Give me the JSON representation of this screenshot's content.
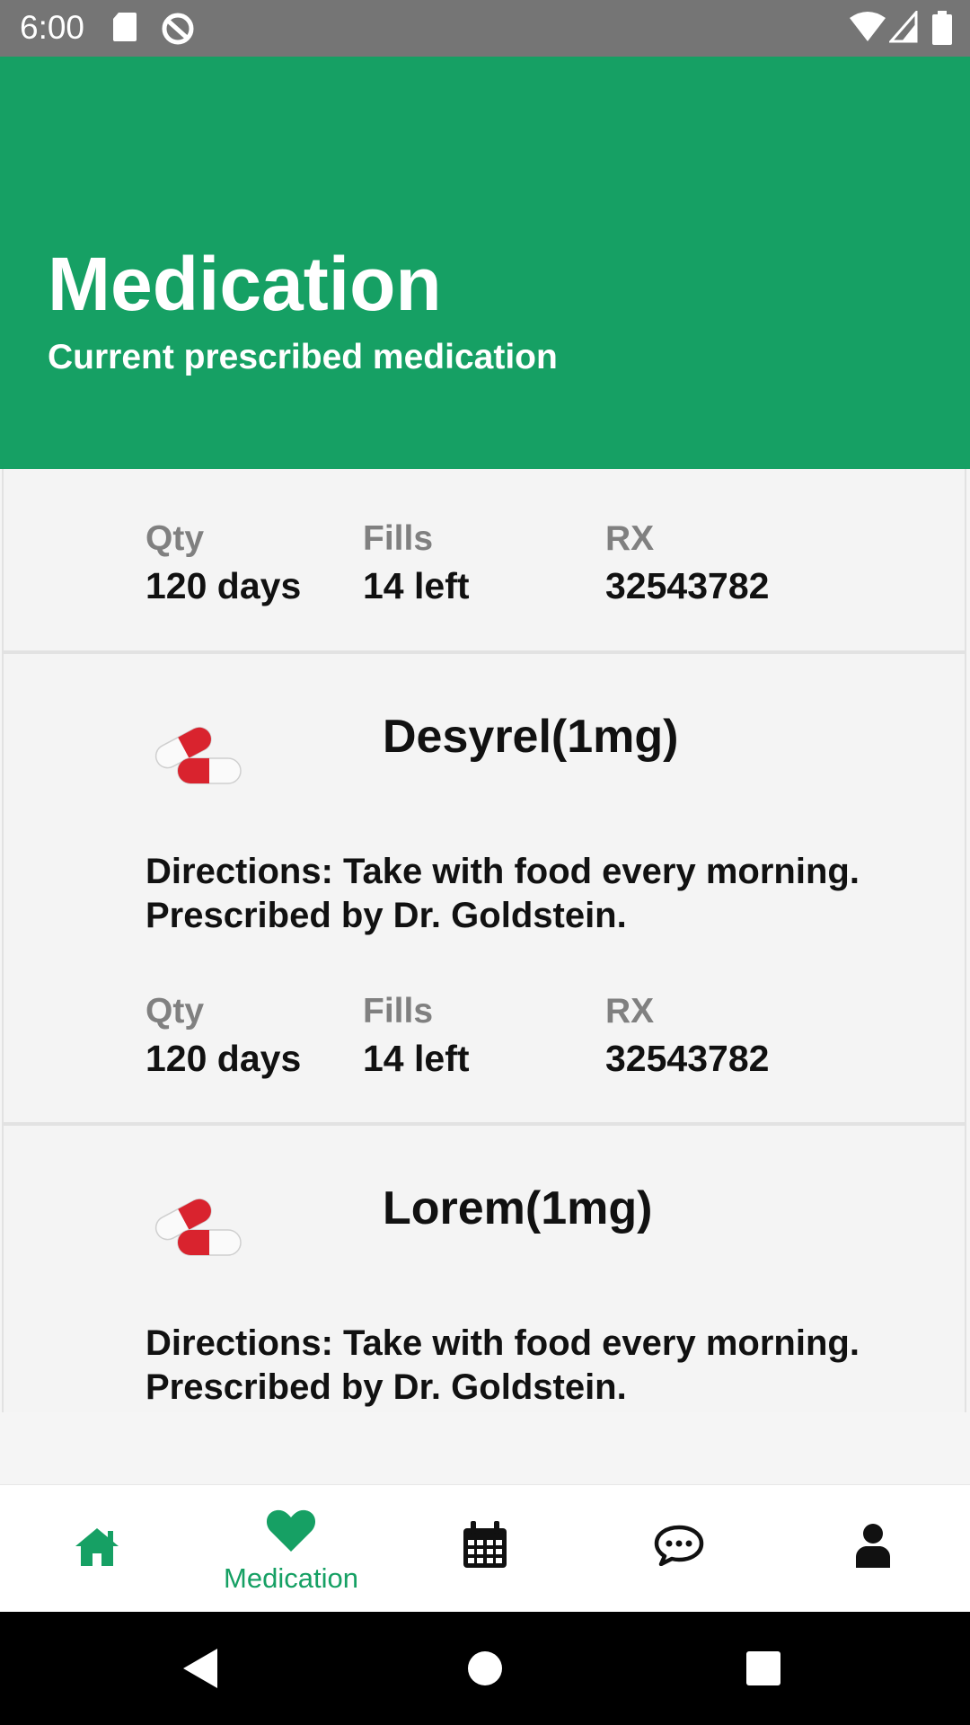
{
  "status_bar": {
    "time": "6:00",
    "icons": [
      "sd-card-icon",
      "vpn-icon",
      "wifi-icon",
      "signal-icon",
      "battery-icon"
    ]
  },
  "header": {
    "title": "Medication",
    "subtitle": "Current prescribed medication"
  },
  "cards": [
    {
      "stats": {
        "qty_label": "Qty",
        "qty_value": "120 days",
        "fills_label": "Fills",
        "fills_value": "14 left",
        "rx_label": "RX",
        "rx_value": "32543782"
      }
    },
    {
      "icon": "pill-capsule-icon",
      "name": "Desyrel(1mg)",
      "directions": "Directions: Take with food every morning. Prescribed by Dr. Goldstein.",
      "stats": {
        "qty_label": "Qty",
        "qty_value": "120 days",
        "fills_label": "Fills",
        "fills_value": "14 left",
        "rx_label": "RX",
        "rx_value": "32543782"
      }
    },
    {
      "icon": "pill-capsule-icon",
      "name": "Lorem(1mg)",
      "directions": "Directions: Take with food every morning. Prescribed by Dr. Goldstein."
    }
  ],
  "bottom_nav": {
    "items": [
      {
        "icon": "home-icon",
        "label": ""
      },
      {
        "icon": "heart-icon",
        "label": "Medication",
        "active": true
      },
      {
        "icon": "calendar-icon",
        "label": ""
      },
      {
        "icon": "chat-icon",
        "label": ""
      },
      {
        "icon": "profile-icon",
        "label": ""
      }
    ]
  },
  "colors": {
    "brand_green": "#16a064",
    "status_bar": "#757575",
    "background": "#f5f5f5"
  }
}
